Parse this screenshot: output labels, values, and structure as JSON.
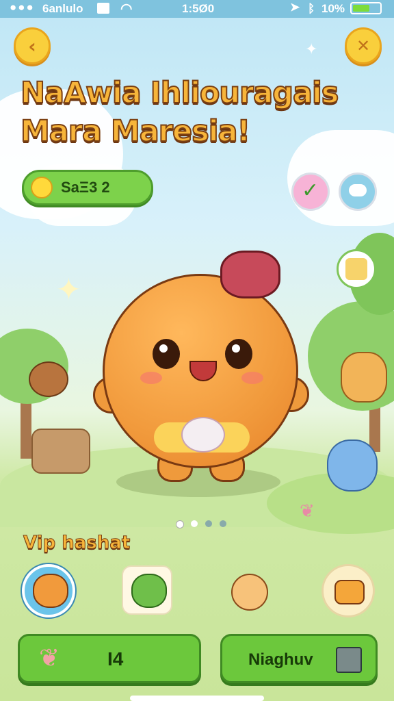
{
  "status_bar": {
    "carrier": "6anlulo",
    "time": "1:5Ø0",
    "battery": "10%"
  },
  "header": {
    "back_icon": "chevron-left-icon",
    "close_icon": "close-icon",
    "title_line1": "NaAwia Ihliouragais",
    "title_line2": "Mara Maresia!"
  },
  "currency": {
    "amount_label": "SaΞ3 2"
  },
  "quick_actions": [
    {
      "name": "check-badge-icon"
    },
    {
      "name": "cloud-icon"
    }
  ],
  "carousel": {
    "pages": 4,
    "active_index": 0
  },
  "pet_section": {
    "label": "Vip hashat",
    "pets": [
      "orange-blob",
      "green-frog",
      "pink-mouse",
      "orange-cat"
    ],
    "selected_index": 0
  },
  "footer": {
    "left_button_label": "I4",
    "right_button_label": "Niaghuv"
  },
  "colors": {
    "accent_green": "#6cc83c",
    "title_yellow": "#f7b53a",
    "mascot_orange": "#f19a3c"
  }
}
